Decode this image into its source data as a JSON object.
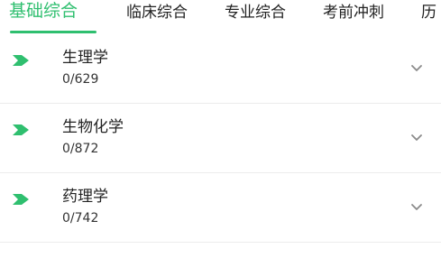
{
  "tabs": [
    {
      "label": "基础综合",
      "active": true
    },
    {
      "label": "临床综合",
      "active": false
    },
    {
      "label": "专业综合",
      "active": false
    },
    {
      "label": "考前冲刺",
      "active": false
    },
    {
      "label": "历",
      "active": false
    }
  ],
  "items": [
    {
      "title": "生理学",
      "progress": "0/629",
      "marker_icon": "chevron-right-marker-icon",
      "expand_icon": "chevron-down-icon"
    },
    {
      "title": "生物化学",
      "progress": "0/872",
      "marker_icon": "chevron-right-marker-icon",
      "expand_icon": "chevron-down-icon"
    },
    {
      "title": "药理学",
      "progress": "0/742",
      "marker_icon": "chevron-right-marker-icon",
      "expand_icon": "chevron-down-icon"
    }
  ],
  "colors": {
    "accent": "#2fbf6f",
    "text": "#222222",
    "divider": "#ececec",
    "chevron": "#8a8a8a"
  }
}
